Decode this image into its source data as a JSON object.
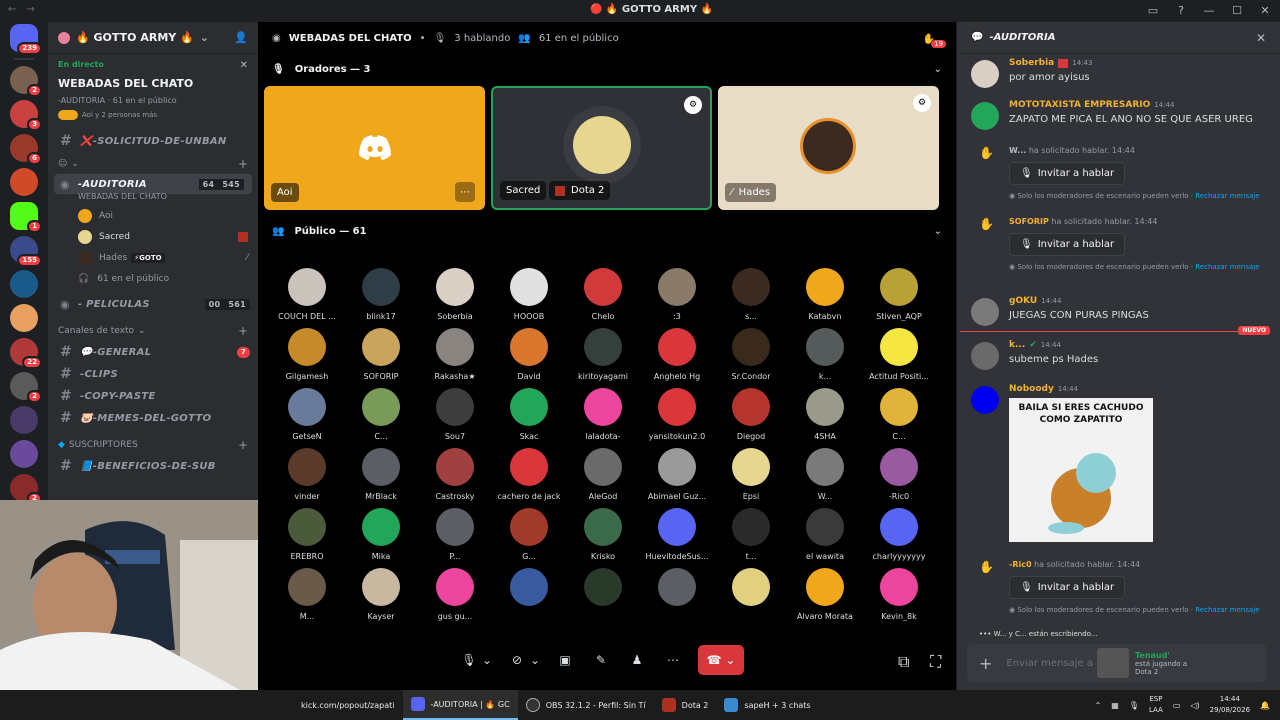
{
  "titlebar": {
    "server_title": "🔴 🔥 GOTTO ARMY 🔥"
  },
  "rail": {
    "badges": [
      "239",
      "2",
      "3",
      "6",
      "",
      "1",
      "155",
      "",
      "",
      "22",
      "2",
      "",
      "",
      "2"
    ]
  },
  "sidebar": {
    "server_name": "🔥 GOTTO ARMY 🔥",
    "live_label": "En directo",
    "live_title": "WEBADAS DEL CHATO",
    "live_channel": "-AUDITORIA",
    "live_public": "61 en el público",
    "live_more": "Aoi y 2 personas más",
    "channels": [
      {
        "name": "❌-SOLICITUD-DE-UNBAN"
      },
      {
        "name": "-AUDITORIA",
        "sub": "WEBADAS DEL CHATO",
        "c1": "64",
        "c2": "545"
      }
    ],
    "speakers": [
      {
        "name": "Aoi"
      },
      {
        "name": "Sacred"
      },
      {
        "name": "Hades",
        "tag": "⚡GOTO"
      },
      {
        "name": "61 en el público"
      }
    ],
    "peliculas": {
      "name": "- PELICULAS",
      "c1": "00",
      "c2": "561"
    },
    "text_category": "Canales de texto",
    "text_channels": [
      {
        "name": "💬-GENERAL",
        "badge": "7"
      },
      {
        "name": "-CLIPS"
      },
      {
        "name": "-COPY-PASTE"
      },
      {
        "name": "🐷-MEMES-DEL-GOTTO"
      }
    ],
    "subs_category": "SUSCRIPTORES",
    "subs_channels": [
      {
        "name": "📘-BENEFICIOS-DE-SUB"
      }
    ]
  },
  "stage": {
    "name": "WEBADAS DEL CHATO",
    "talking": "3 hablando",
    "public": "61 en el público",
    "badge": "19",
    "speakers_label": "Oradores — 3",
    "public_label": "Público — 61",
    "tiles": [
      {
        "name": "Aoi",
        "bg": "#f0a71c"
      },
      {
        "name": "Sacred",
        "game": "Dota 2",
        "bg": "#2f3136"
      },
      {
        "name": "Hades",
        "bg": "#e8dcc6"
      }
    ]
  },
  "audience": [
    {
      "name": "COUCH DEL ...",
      "color": "#c9c3bb"
    },
    {
      "name": "blink17",
      "color": "#2f3d46"
    },
    {
      "name": "Soberbia",
      "color": "#d9cfc4"
    },
    {
      "name": "HOOOB",
      "color": "#e0e0e0"
    },
    {
      "name": "Chelo",
      "color": "#d13a3a"
    },
    {
      "name": ":3",
      "color": "#8a7a6a"
    },
    {
      "name": "s...",
      "color": "#3b2a20"
    },
    {
      "name": "Katabvn",
      "color": "#f0a71c"
    },
    {
      "name": "Stiven_AQP",
      "color": "#b8a238"
    },
    {
      "name": "Gilgamesh",
      "color": "#c78a2a"
    },
    {
      "name": "SOFORIP",
      "color": "#c9a45c"
    },
    {
      "name": "Rakasha★",
      "color": "#8a8480"
    },
    {
      "name": "David",
      "color": "#d9772e"
    },
    {
      "name": "kiritoyagami",
      "color": "#34403b"
    },
    {
      "name": "Anghelo Hg",
      "color": "#da373c"
    },
    {
      "name": "Sr.Condor",
      "color": "#3a2a1c"
    },
    {
      "name": "k...",
      "color": "#555a5a"
    },
    {
      "name": "Actitud Positi...",
      "color": "#f5e642"
    },
    {
      "name": "GetseN",
      "color": "#6a7a9a"
    },
    {
      "name": "C...",
      "color": "#7a9a5a"
    },
    {
      "name": "Sou7",
      "color": "#3d3d3d"
    },
    {
      "name": "Skac",
      "color": "#23a55a"
    },
    {
      "name": "laladota-",
      "color": "#eb459e"
    },
    {
      "name": "yansitokun2.0",
      "color": "#da373c"
    },
    {
      "name": "Diegod",
      "color": "#b5352e"
    },
    {
      "name": "4SHA",
      "color": "#9a9a8a"
    },
    {
      "name": "C...",
      "color": "#e0b43a"
    },
    {
      "name": "vinder",
      "color": "#5a3a2a"
    },
    {
      "name": "MrBlack",
      "color": "#5c5e66"
    },
    {
      "name": "Castrosky",
      "color": "#a04040"
    },
    {
      "name": "cachero de jack",
      "color": "#da373c"
    },
    {
      "name": "AleGod",
      "color": "#6a6a6a"
    },
    {
      "name": "Abimael Guz...",
      "color": "#9a9a9a"
    },
    {
      "name": "Epsi",
      "color": "#e6d690"
    },
    {
      "name": "W...",
      "color": "#7a7a7a"
    },
    {
      "name": "-Ric0",
      "color": "#9a5aa0"
    },
    {
      "name": "EREBRO",
      "color": "#4a5a3a"
    },
    {
      "name": "Mika",
      "color": "#23a55a"
    },
    {
      "name": "P...",
      "color": "#5c5e66"
    },
    {
      "name": "G...",
      "color": "#a03a2a"
    },
    {
      "name": "Krisko",
      "color": "#3a6a4a"
    },
    {
      "name": "HuevitodeSus...",
      "color": "#5865f2"
    },
    {
      "name": "t...",
      "color": "#2a2a2a"
    },
    {
      "name": "el wawita",
      "color": "#3a3a3a"
    },
    {
      "name": "charlyyyyyyy",
      "color": "#5865f2"
    },
    {
      "name": "M...",
      "color": "#6a5a4a"
    },
    {
      "name": "Kayser",
      "color": "#c9b8a0"
    },
    {
      "name": "gus gu...",
      "color": "#eb459e"
    },
    {
      "name": "",
      "color": "#3a5aa0"
    },
    {
      "name": "",
      "color": "#2a3a2a"
    },
    {
      "name": "",
      "color": "#5c5e66"
    },
    {
      "name": "",
      "color": "#e0d080"
    },
    {
      "name": "Alvaro Morata",
      "color": "#f0a71c"
    },
    {
      "name": "Kevin_8k",
      "color": "#eb459e"
    }
  ],
  "chat": {
    "channel": "-AUDITORIA",
    "messages": [
      {
        "author": "Soberbia",
        "author_color": "#f0b232",
        "time": "14:43",
        "text": "por amor ayisus"
      },
      {
        "author": "MOTOTAXISTA EMPRESARIO",
        "author_color": "#f0b232",
        "time": "14:44",
        "text": "ZAPATO ME PICA EL ANO NO SE QUE ASER  UREG"
      },
      {
        "author": "gOKU",
        "author_color": "#f0b232",
        "time": "14:44",
        "text": "JUEGAS CON PURAS PINGAS"
      },
      {
        "author": "k...",
        "author_color": "#f0b232",
        "time": "14:44",
        "text": "subeme ps Hades"
      },
      {
        "author": "Noboody",
        "author_color": "#f0b232",
        "time": "14:44",
        "text": ""
      }
    ],
    "requests": [
      {
        "user": "W...",
        "time": "14:44"
      },
      {
        "user": "SOFORIP",
        "time": "14:44"
      },
      {
        "user": "-Ric0",
        "time": "14:44"
      }
    ],
    "request_text": "ha solicitado hablar.",
    "invite_label": "Invitar a hablar",
    "mod_note": "Solo los moderadores de escenario pueden verlo",
    "reject_label": "Rechazar mensaje",
    "new_label": "NUEVO",
    "meme_caption": "BAILA SI ERES CACHUDO COMO ZAPATITO",
    "typing": "W... y C... están escribiendo...",
    "compose_placeholder": "Enviar mensaje a",
    "activity_name": "Tenaud'",
    "activity_status": "está jugando a",
    "activity_game": "Dota 2"
  },
  "taskbar": {
    "items": [
      "kick.com/popout/zapati",
      "-AUDITORIA | 🔥 GC",
      "OBS 32.1.2 - Perfil: Sin Tí",
      "Dota 2",
      "sapeH + 3 chats"
    ],
    "lang": "ESP",
    "layout": "LAA",
    "time": "14:44",
    "date": "29/08/2026"
  }
}
